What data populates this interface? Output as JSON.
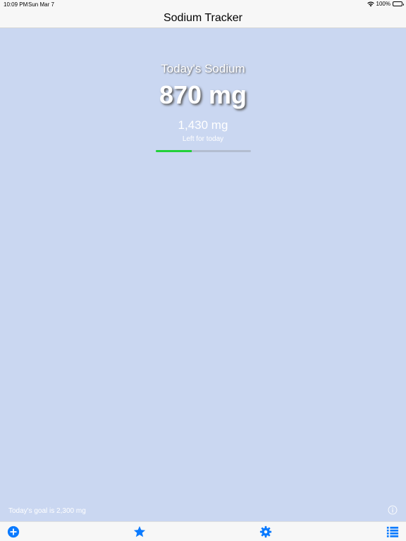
{
  "status_bar": {
    "time": "10:09 PM",
    "date": "Sun Mar 7",
    "battery": "100%"
  },
  "nav": {
    "title": "Sodium Tracker"
  },
  "summary": {
    "heading": "Today's Sodium",
    "total": "870 mg",
    "remaining": "1,430 mg",
    "remaining_label": "Left for today",
    "progress_fraction": 0.378
  },
  "footer": {
    "goal_text": "Today's goal is 2,300 mg"
  },
  "tabs": [
    {
      "name": "add",
      "icon": "plus-circle-icon"
    },
    {
      "name": "favorites",
      "icon": "star-icon"
    },
    {
      "name": "settings",
      "icon": "gear-icon"
    },
    {
      "name": "history",
      "icon": "list-icon"
    }
  ],
  "colors": {
    "background": "#cad7f1",
    "accent": "#0a7aff",
    "progress": "#22d13a"
  }
}
